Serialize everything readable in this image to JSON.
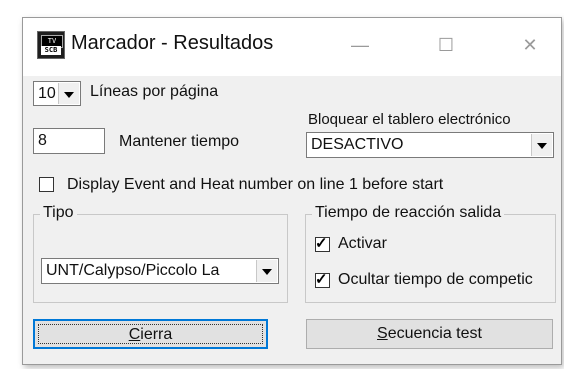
{
  "window": {
    "title": "Marcador - Resultados",
    "minimize_glyph": "—",
    "maximize_glyph": "☐",
    "close_glyph": "✕",
    "icon_top_text": "TV",
    "icon_bottom_text": "SCB"
  },
  "lines_per_page": {
    "value": "10",
    "label": "Líneas por página"
  },
  "hold_time": {
    "value": "8",
    "label": "Mantener tiempo"
  },
  "lock_board": {
    "label": "Bloquear el tablero electrónico",
    "value": "DESACTIVO"
  },
  "display_event": {
    "label": "Display Event and Heat number on line 1 before start",
    "checked": false
  },
  "tipo": {
    "group_label": "Tipo",
    "value": "UNT/Calypso/Piccolo La"
  },
  "reaction": {
    "group_label": "Tiempo de reacción salida",
    "activar": {
      "label": "Activar",
      "checked": true
    },
    "ocultar": {
      "label": "Ocultar tiempo de competic",
      "checked": true
    }
  },
  "buttons": {
    "close": {
      "first": "C",
      "rest": "ierra"
    },
    "test": {
      "first": "S",
      "rest": "ecuencia test"
    }
  },
  "colors": {
    "accent": "#0078d7",
    "face": "#f0f0f0"
  }
}
